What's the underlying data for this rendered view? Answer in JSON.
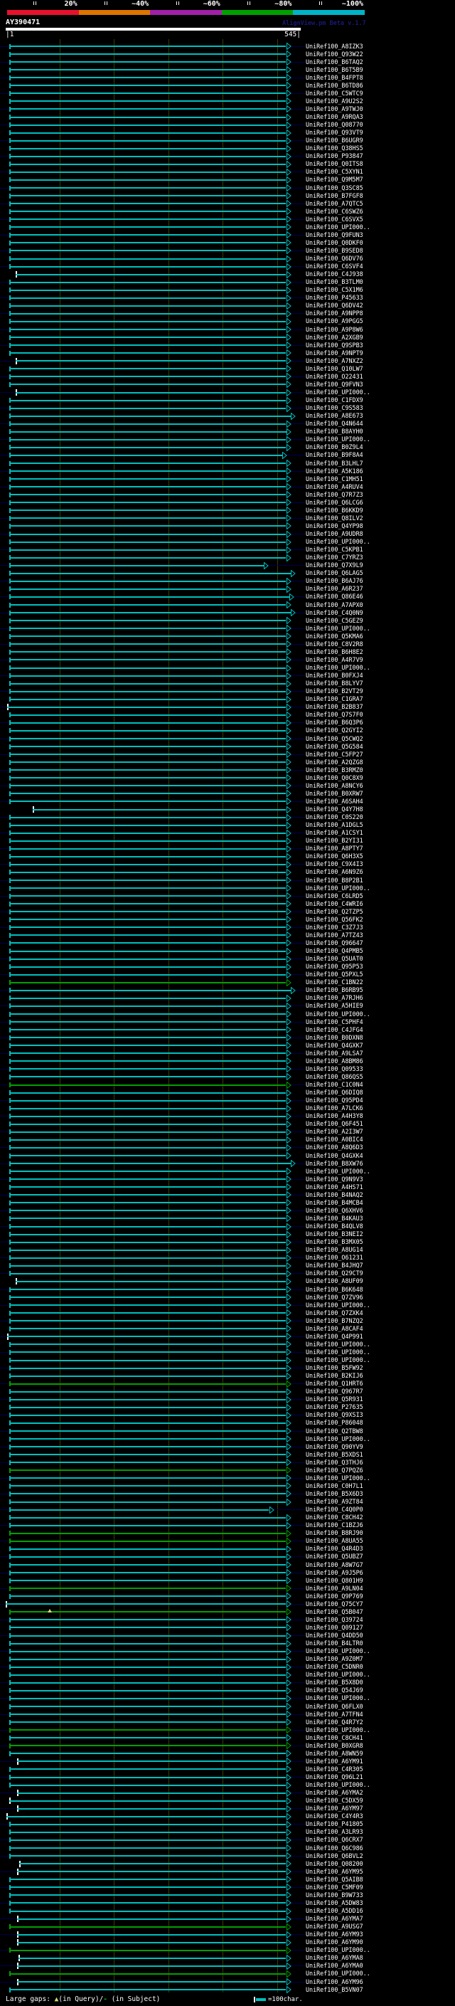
{
  "header": {
    "title": "AY390471",
    "watermark": "AlignView.pm Beta v.1.7",
    "scale": {
      "segments": [
        {
          "label": "20%",
          "color": "#e8112d"
        },
        {
          "label": "~40%",
          "color": "#dd7500"
        },
        {
          "label": "~60%",
          "color": "#a020a8"
        },
        {
          "label": "~80%",
          "color": "#00a000"
        },
        {
          "label": "~100%",
          "color": "#00b4c8"
        }
      ]
    }
  },
  "ruler": {
    "start_label": "|1",
    "end_label": "545|",
    "start": 1,
    "end": 545
  },
  "legend": {
    "large_gaps_label": "Large gaps: ",
    "query_gap_symbol": "▲",
    "query_gap_text": "(in Query)/",
    "subject_gap_symbol": "-",
    "subject_gap_text": " (in Subject)",
    "scale_label": "=100char."
  },
  "colors": {
    "background": "#000000",
    "identity_high": "#00bfbf",
    "identity_mid": "#00a000",
    "connector": "#000050",
    "gridline": "#3c3c00",
    "white_tick": "#ffffff",
    "gap_marker": "#d8d878",
    "watermark": "#181875",
    "text": "#ffffff"
  },
  "chart_data": {
    "type": "alignment-overview",
    "title": "AY390471",
    "query": {
      "id": "AY390471",
      "start": 1,
      "end": 545
    },
    "identity_bins": [
      {
        "label": "20%",
        "color": "#e8112d"
      },
      {
        "label": "~40%",
        "color": "#dd7500"
      },
      {
        "label": "~60%",
        "color": "#a020a8"
      },
      {
        "label": "~80%",
        "color": "#00a000"
      },
      {
        "label": "~100%",
        "color": "#00b4c8"
      }
    ],
    "note_fields": "g=1 means ~60-80% identity (green bar), otherwise ~80-100% (cyan); s/e/a are bar start/end/arrow-tip in px (13..402 maps to query 1..545); w=1 white start tick; gap = large-gap marker px",
    "hits": [
      {
        "id": "UniRef100_A8IZK3"
      },
      {
        "id": "UniRef100_Q93W22"
      },
      {
        "id": "UniRef100_B6TAQ2"
      },
      {
        "id": "UniRef100_B6T5B9"
      },
      {
        "id": "UniRef100_B4FPT8"
      },
      {
        "id": "UniRef100_B6TD86"
      },
      {
        "id": "UniRef100_C5WTC9"
      },
      {
        "id": "UniRef100_A9U2S2"
      },
      {
        "id": "UniRef100_A9TWJ0"
      },
      {
        "id": "UniRef100_A9RQA3"
      },
      {
        "id": "UniRef100_Q08770"
      },
      {
        "id": "UniRef100_Q93VT9"
      },
      {
        "id": "UniRef100_B6UGR9"
      },
      {
        "id": "UniRef100_Q38HS5"
      },
      {
        "id": "UniRef100_P93847"
      },
      {
        "id": "UniRef100_Q0ITS8"
      },
      {
        "id": "UniRef100_C5XYN1"
      },
      {
        "id": "UniRef100_Q9M5M7"
      },
      {
        "id": "UniRef100_Q3SC85"
      },
      {
        "id": "UniRef100_B7FGF8"
      },
      {
        "id": "UniRef100_A7QTC5"
      },
      {
        "id": "UniRef100_C6SWZ6"
      },
      {
        "id": "UniRef100_C6SVX5"
      },
      {
        "id": "UniRef100_UPI000.."
      },
      {
        "id": "UniRef100_Q9FUN3"
      },
      {
        "id": "UniRef100_Q0DKF0"
      },
      {
        "id": "UniRef100_B9SED8"
      },
      {
        "id": "UniRef100_Q6DV76"
      },
      {
        "id": "UniRef100_C6SVF4"
      },
      {
        "id": "UniRef100_C4J938",
        "s": 22,
        "w": 1
      },
      {
        "id": "UniRef100_B3TLM0"
      },
      {
        "id": "UniRef100_C5X1M6"
      },
      {
        "id": "UniRef100_P45633"
      },
      {
        "id": "UniRef100_Q6DV42"
      },
      {
        "id": "UniRef100_A9NPP8"
      },
      {
        "id": "UniRef100_A9PGG5"
      },
      {
        "id": "UniRef100_A9P8W6"
      },
      {
        "id": "UniRef100_A2XGB9"
      },
      {
        "id": "UniRef100_Q9SPB3"
      },
      {
        "id": "UniRef100_A9NPT9"
      },
      {
        "id": "UniRef100_A7NXZ2",
        "s": 22,
        "w": 1
      },
      {
        "id": "UniRef100_Q10LW7"
      },
      {
        "id": "UniRef100_O22431"
      },
      {
        "id": "UniRef100_Q9FVN3"
      },
      {
        "id": "UniRef100_UPI000..",
        "s": 22,
        "w": 1
      },
      {
        "id": "UniRef100_C1FDX9"
      },
      {
        "id": "UniRef100_C9S583"
      },
      {
        "id": "UniRef100_A8E673",
        "e": 410,
        "a": 415
      },
      {
        "id": "UniRef100_Q4N644"
      },
      {
        "id": "UniRef100_B8AYH0",
        "e": 404,
        "a": 409
      },
      {
        "id": "UniRef100_UPI000.."
      },
      {
        "id": "UniRef100_B0Z9L4"
      },
      {
        "id": "UniRef100_B9F8A4",
        "e": 398,
        "a": 403
      },
      {
        "id": "UniRef100_B3LHL7"
      },
      {
        "id": "UniRef100_A5K186"
      },
      {
        "id": "UniRef100_C1MH51"
      },
      {
        "id": "UniRef100_A4RUV4"
      },
      {
        "id": "UniRef100_Q7R7Z3"
      },
      {
        "id": "UniRef100_Q6LCG6"
      },
      {
        "id": "UniRef100_B6KKD9"
      },
      {
        "id": "UniRef100_Q8ILV2"
      },
      {
        "id": "UniRef100_Q4YP98"
      },
      {
        "id": "UniRef100_A9UDR8"
      },
      {
        "id": "UniRef100_UPI000.."
      },
      {
        "id": "UniRef100_C5KPB1"
      },
      {
        "id": "UniRef100_C7YRZ3"
      },
      {
        "id": "UniRef100_Q7X9L9",
        "e": 372,
        "a": 377
      },
      {
        "id": "UniRef100_Q6LAG5",
        "e": 410,
        "a": 415
      },
      {
        "id": "UniRef100_B6AJ76"
      },
      {
        "id": "UniRef100_A6R237"
      },
      {
        "id": "UniRef100_Q86E46",
        "e": 408,
        "a": 413
      },
      {
        "id": "UniRef100_A7APX0"
      },
      {
        "id": "UniRef100_C4Q0N9",
        "e": 410,
        "a": 415
      },
      {
        "id": "UniRef100_C5GEZ9"
      },
      {
        "id": "UniRef100_UPI000.."
      },
      {
        "id": "UniRef100_Q5KMA6"
      },
      {
        "id": "UniRef100_C8V2R8"
      },
      {
        "id": "UniRef100_B6H8E2"
      },
      {
        "id": "UniRef100_A4R7V9"
      },
      {
        "id": "UniRef100_UPI000.."
      },
      {
        "id": "UniRef100_B0FXJ4"
      },
      {
        "id": "UniRef100_B8LYV7"
      },
      {
        "id": "UniRef100_B2VT29"
      },
      {
        "id": "UniRef100_C1GRA7"
      },
      {
        "id": "UniRef100_B2B837",
        "s": 10,
        "w": 1
      },
      {
        "id": "UniRef100_Q7S7F0"
      },
      {
        "id": "UniRef100_B6Q3P6"
      },
      {
        "id": "UniRef100_Q2GYI2"
      },
      {
        "id": "UniRef100_Q5CWQ2"
      },
      {
        "id": "UniRef100_Q5G584"
      },
      {
        "id": "UniRef100_C5FP27"
      },
      {
        "id": "UniRef100_A2QZG8"
      },
      {
        "id": "UniRef100_B3RMZ0"
      },
      {
        "id": "UniRef100_Q0C8X9"
      },
      {
        "id": "UniRef100_A8NCY6"
      },
      {
        "id": "UniRef100_B0XRW7"
      },
      {
        "id": "UniRef100_A6SAH4"
      },
      {
        "id": "UniRef100_Q4Y7H8",
        "s": 46,
        "w": 1
      },
      {
        "id": "UniRef100_C0S220"
      },
      {
        "id": "UniRef100_A1DGL5"
      },
      {
        "id": "UniRef100_A1CSY1"
      },
      {
        "id": "UniRef100_B2YI31"
      },
      {
        "id": "UniRef100_A8PTY7"
      },
      {
        "id": "UniRef100_Q6H3X5"
      },
      {
        "id": "UniRef100_C9X4I3"
      },
      {
        "id": "UniRef100_A6N9Z6"
      },
      {
        "id": "UniRef100_B8P2B1"
      },
      {
        "id": "UniRef100_UPI000.."
      },
      {
        "id": "UniRef100_C6LRD5"
      },
      {
        "id": "UniRef100_C4WRI6"
      },
      {
        "id": "UniRef100_Q2TZP5"
      },
      {
        "id": "UniRef100_Q56FK2"
      },
      {
        "id": "UniRef100_C3Z7J3"
      },
      {
        "id": "UniRef100_A7TZ43"
      },
      {
        "id": "UniRef100_Q96647"
      },
      {
        "id": "UniRef100_Q4PMB5"
      },
      {
        "id": "UniRef100_Q5UAT0"
      },
      {
        "id": "UniRef100_Q95P53"
      },
      {
        "id": "UniRef100_Q5PXL5"
      },
      {
        "id": "UniRef100_C1BN22",
        "g": 1
      },
      {
        "id": "UniRef100_B6RB95",
        "e": 410,
        "a": 415
      },
      {
        "id": "UniRef100_A7RJH6"
      },
      {
        "id": "UniRef100_A5HIE9"
      },
      {
        "id": "UniRef100_UPI000.."
      },
      {
        "id": "UniRef100_C5PHF4"
      },
      {
        "id": "UniRef100_C4JFG4"
      },
      {
        "id": "UniRef100_B0DXN8"
      },
      {
        "id": "UniRef100_Q4GXK7"
      },
      {
        "id": "UniRef100_A9LSA7"
      },
      {
        "id": "UniRef100_A8BM86"
      },
      {
        "id": "UniRef100_Q09533"
      },
      {
        "id": "UniRef100_Q86QS5"
      },
      {
        "id": "UniRef100_C1C0N4",
        "g": 1
      },
      {
        "id": "UniRef100_Q6DIQ8"
      },
      {
        "id": "UniRef100_Q95PD4"
      },
      {
        "id": "UniRef100_A7LCK6"
      },
      {
        "id": "UniRef100_A4H3Y8"
      },
      {
        "id": "UniRef100_Q6F451"
      },
      {
        "id": "UniRef100_A2I3W7"
      },
      {
        "id": "UniRef100_A0BIC4"
      },
      {
        "id": "UniRef100_A8Q6D3"
      },
      {
        "id": "UniRef100_Q4GXK4"
      },
      {
        "id": "UniRef100_B8XW76",
        "e": 410,
        "a": 415
      },
      {
        "id": "UniRef100_UPI000.."
      },
      {
        "id": "UniRef100_Q9N9V3"
      },
      {
        "id": "UniRef100_A4HS71"
      },
      {
        "id": "UniRef100_B4NAQ2"
      },
      {
        "id": "UniRef100_B4MCB4"
      },
      {
        "id": "UniRef100_Q6XHV6"
      },
      {
        "id": "UniRef100_B4KAU3"
      },
      {
        "id": "UniRef100_B4QLV8"
      },
      {
        "id": "UniRef100_B3NEI2"
      },
      {
        "id": "UniRef100_B3MX05"
      },
      {
        "id": "UniRef100_A8UG14"
      },
      {
        "id": "UniRef100_O61231"
      },
      {
        "id": "UniRef100_B4JHQ7"
      },
      {
        "id": "UniRef100_Q29CT9"
      },
      {
        "id": "UniRef100_A8UF09",
        "s": 22,
        "w": 1
      },
      {
        "id": "UniRef100_B6K648"
      },
      {
        "id": "UniRef100_Q7ZV96"
      },
      {
        "id": "UniRef100_UPI000.."
      },
      {
        "id": "UniRef100_Q7ZXK4"
      },
      {
        "id": "UniRef100_B7NZQ2"
      },
      {
        "id": "UniRef100_A8CAF4"
      },
      {
        "id": "UniRef100_Q4P991",
        "s": 10,
        "w": 1
      },
      {
        "id": "UniRef100_UPI000.."
      },
      {
        "id": "UniRef100_UPI000.."
      },
      {
        "id": "UniRef100_UPI000.."
      },
      {
        "id": "UniRef100_B5FW92"
      },
      {
        "id": "UniRef100_B2KIJ6"
      },
      {
        "id": "UniRef100_Q1HRT6",
        "g": 1
      },
      {
        "id": "UniRef100_Q967R7"
      },
      {
        "id": "UniRef100_Q5R931"
      },
      {
        "id": "UniRef100_P27635"
      },
      {
        "id": "UniRef100_Q9XSI3"
      },
      {
        "id": "UniRef100_P86048"
      },
      {
        "id": "UniRef100_Q2TBW8"
      },
      {
        "id": "UniRef100_UPI000.."
      },
      {
        "id": "UniRef100_Q90YV9"
      },
      {
        "id": "UniRef100_B5XDS1"
      },
      {
        "id": "UniRef100_Q3THJ6"
      },
      {
        "id": "UniRef100_Q7PQZ6",
        "g": 1
      },
      {
        "id": "UniRef100_UPI000.."
      },
      {
        "id": "UniRef100_C0H7L1"
      },
      {
        "id": "UniRef100_B5X6D3"
      },
      {
        "id": "UniRef100_A9ZT84"
      },
      {
        "id": "UniRef100_C4Q0P0",
        "e": 378,
        "a": 385
      },
      {
        "id": "UniRef100_C8CH42"
      },
      {
        "id": "UniRef100_C1BZJ6"
      },
      {
        "id": "UniRef100_B8RJ90",
        "g": 1
      },
      {
        "id": "UniRef100_A8UA55",
        "g": 1
      },
      {
        "id": "UniRef100_Q4R4D3"
      },
      {
        "id": "UniRef100_Q5UBZ7"
      },
      {
        "id": "UniRef100_A8W7G7"
      },
      {
        "id": "UniRef100_A9J5P6"
      },
      {
        "id": "UniRef100_Q801H9"
      },
      {
        "id": "UniRef100_A9LN04",
        "g": 1
      },
      {
        "id": "UniRef100_Q9P769"
      },
      {
        "id": "UniRef100_Q75CY7",
        "s": 8,
        "w": 1
      },
      {
        "id": "UniRef100_Q5B047",
        "g": 1,
        "gap": 70
      },
      {
        "id": "UniRef100_Q39724"
      },
      {
        "id": "UniRef100_Q09127"
      },
      {
        "id": "UniRef100_Q4DD50"
      },
      {
        "id": "UniRef100_B4LTR0"
      },
      {
        "id": "UniRef100_UPI000.."
      },
      {
        "id": "UniRef100_A9Z0M7"
      },
      {
        "id": "UniRef100_C5DNR0"
      },
      {
        "id": "UniRef100_UPI000.."
      },
      {
        "id": "UniRef100_B5X8D0"
      },
      {
        "id": "UniRef100_Q54J69"
      },
      {
        "id": "UniRef100_UPI000.."
      },
      {
        "id": "UniRef100_Q6FLX0"
      },
      {
        "id": "UniRef100_A7TFN4"
      },
      {
        "id": "UniRef100_Q4R7Y2"
      },
      {
        "id": "UniRef100_UPI000..",
        "g": 1
      },
      {
        "id": "UniRef100_C8CH41"
      },
      {
        "id": "UniRef100_B0XGR8",
        "g": 1
      },
      {
        "id": "UniRef100_A8WN59"
      },
      {
        "id": "UniRef100_A6YM91",
        "s": 24,
        "w": 1
      },
      {
        "id": "UniRef100_C4R305"
      },
      {
        "id": "UniRef100_Q96L21"
      },
      {
        "id": "UniRef100_UPI000.."
      },
      {
        "id": "UniRef100_A6YMA2",
        "s": 24,
        "w": 1
      },
      {
        "id": "UniRef100_C5DX59",
        "s": 13,
        "w": 1
      },
      {
        "id": "UniRef100_A6YM97",
        "s": 24,
        "w": 1
      },
      {
        "id": "UniRef100_C4Y4R3",
        "s": 9,
        "w": 1
      },
      {
        "id": "UniRef100_P41805"
      },
      {
        "id": "UniRef100_A3LR93"
      },
      {
        "id": "UniRef100_Q6CRX7"
      },
      {
        "id": "UniRef100_Q6C986"
      },
      {
        "id": "UniRef100_Q6BVL2"
      },
      {
        "id": "UniRef100_Q08200",
        "s": 27,
        "w": 1
      },
      {
        "id": "UniRef100_A6YM95",
        "s": 24,
        "w": 1
      },
      {
        "id": "UniRef100_Q5AIB8"
      },
      {
        "id": "UniRef100_C5MF09"
      },
      {
        "id": "UniRef100_B9W733"
      },
      {
        "id": "UniRef100_A5DW83"
      },
      {
        "id": "UniRef100_A5DD16"
      },
      {
        "id": "UniRef100_A6YMA7",
        "s": 24,
        "w": 1
      },
      {
        "id": "UniRef100_A9USG7",
        "g": 1
      },
      {
        "id": "UniRef100_A6YM93",
        "s": 24,
        "w": 1
      },
      {
        "id": "UniRef100_A6YM90",
        "s": 24,
        "w": 1
      },
      {
        "id": "UniRef100_UPI000..",
        "g": 1
      },
      {
        "id": "UniRef100_A6YMA8",
        "s": 26,
        "w": 1
      },
      {
        "id": "UniRef100_A6YMA0",
        "s": 24,
        "w": 1
      },
      {
        "id": "UniRef100_UPI000..",
        "g": 1
      },
      {
        "id": "UniRef100_A6YM96",
        "s": 24,
        "w": 1
      },
      {
        "id": "UniRef100_B5VN07"
      }
    ]
  }
}
